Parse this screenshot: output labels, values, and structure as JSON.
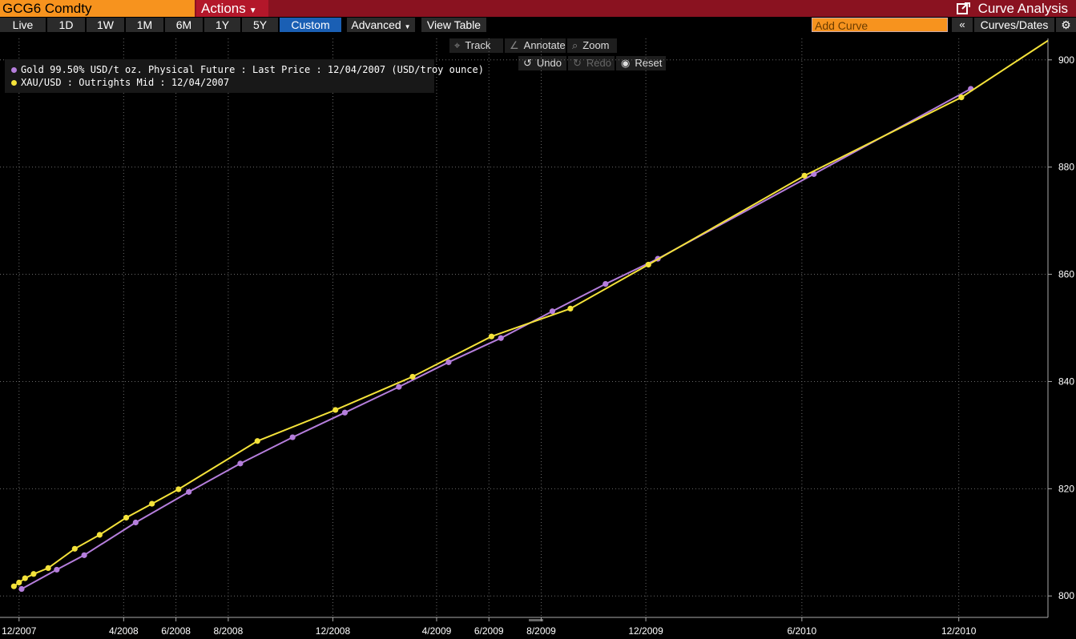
{
  "header": {
    "ticker": "GCG6 Comdty",
    "actions_label": "Actions",
    "title": "Curve Analysis"
  },
  "toolbar": {
    "ranges": [
      "Live",
      "1D",
      "1W",
      "1M",
      "6M",
      "1Y",
      "5Y",
      "Custom"
    ],
    "active_range": "Custom",
    "advanced_label": "Advanced",
    "view_table_label": "View Table",
    "add_curve_placeholder": "Add Curve",
    "curves_dates_label": "Curves/Dates"
  },
  "chart_tools": {
    "track": "Track",
    "annotate": "Annotate",
    "zoom": "Zoom",
    "undo": "Undo",
    "redo": "Redo",
    "reset": "Reset"
  },
  "colors": {
    "header_bg": "#8a1220",
    "ticker_bg": "#f7931e",
    "active_button": "#1a5fb4",
    "series_gold": "#b57edc",
    "series_xau": "#f4e23a",
    "grid": "#6a6a6a"
  },
  "chart_data": {
    "type": "line",
    "title": "",
    "xlabel": "",
    "ylabel": "",
    "y_axis_side": "right",
    "ylim": [
      796,
      904
    ],
    "yticks": [
      800,
      820,
      840,
      860,
      880,
      900
    ],
    "x_axis_type": "date",
    "xlim": [
      "2007-11-20",
      "2011-03-15"
    ],
    "xticks": [
      {
        "date": "2007-12-01",
        "label": "12/2007"
      },
      {
        "date": "2008-04-01",
        "label": "4/2008"
      },
      {
        "date": "2008-06-01",
        "label": "6/2008"
      },
      {
        "date": "2008-08-01",
        "label": "8/2008"
      },
      {
        "date": "2008-12-01",
        "label": "12/2008"
      },
      {
        "date": "2009-04-01",
        "label": "4/2009"
      },
      {
        "date": "2009-06-01",
        "label": "6/2009"
      },
      {
        "date": "2009-08-01",
        "label": "8/2009"
      },
      {
        "date": "2009-12-01",
        "label": "12/2009"
      },
      {
        "date": "2010-06-01",
        "label": "6/2010"
      },
      {
        "date": "2010-12-01",
        "label": "12/2010"
      }
    ],
    "grid": true,
    "legend_position": "top-left",
    "series": [
      {
        "name": "Gold 99.50% USD/t oz. Physical Future : Last Price : 12/04/2007 (USD/troy ounce)",
        "color": "#b57edc",
        "points": [
          [
            "2007-12-04",
            801.3
          ],
          [
            "2008-01-14",
            804.9
          ],
          [
            "2008-02-15",
            807.6
          ],
          [
            "2008-04-15",
            813.7
          ],
          [
            "2008-06-16",
            819.4
          ],
          [
            "2008-08-15",
            824.7
          ],
          [
            "2008-10-15",
            829.6
          ],
          [
            "2008-12-15",
            834.2
          ],
          [
            "2009-02-16",
            839.0
          ],
          [
            "2009-04-15",
            843.6
          ],
          [
            "2009-06-15",
            848.1
          ],
          [
            "2009-08-14",
            853.1
          ],
          [
            "2009-10-15",
            858.2
          ],
          [
            "2009-12-15",
            862.9
          ],
          [
            "2010-06-15",
            878.7
          ],
          [
            "2010-12-15",
            894.6
          ]
        ]
      },
      {
        "name": "XAU/USD : Outrights Mid : 12/04/2007",
        "color": "#f4e23a",
        "points": [
          [
            "2007-11-25",
            801.8
          ],
          [
            "2007-12-01",
            802.5
          ],
          [
            "2007-12-08",
            803.3
          ],
          [
            "2007-12-18",
            804.1
          ],
          [
            "2008-01-04",
            805.2
          ],
          [
            "2008-02-04",
            808.8
          ],
          [
            "2008-03-04",
            811.4
          ],
          [
            "2008-04-04",
            814.6
          ],
          [
            "2008-05-04",
            817.2
          ],
          [
            "2008-06-04",
            819.9
          ],
          [
            "2008-09-04",
            828.9
          ],
          [
            "2008-12-04",
            834.7
          ],
          [
            "2009-03-04",
            840.9
          ],
          [
            "2009-06-04",
            848.4
          ],
          [
            "2009-09-04",
            853.6
          ],
          [
            "2009-12-04",
            861.8
          ],
          [
            "2010-06-04",
            878.4
          ],
          [
            "2010-12-04",
            893.0
          ],
          [
            "2011-03-15",
            903.6
          ]
        ]
      }
    ]
  }
}
